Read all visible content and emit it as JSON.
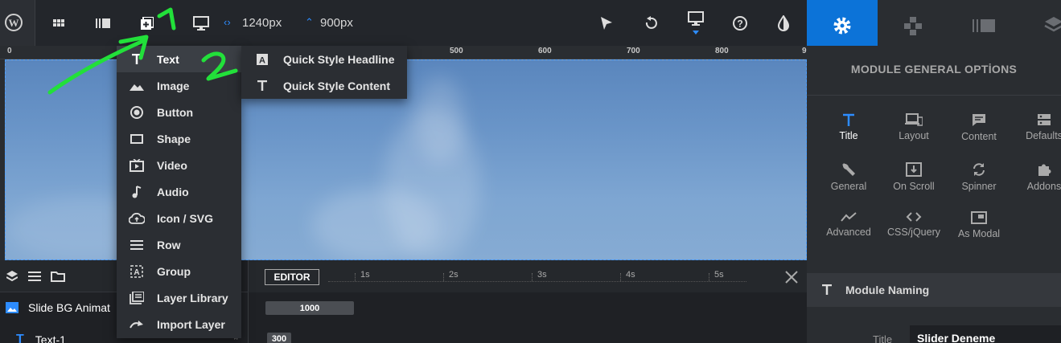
{
  "toolbar": {
    "width_value": "1240px",
    "height_value": "900px"
  },
  "ruler": {
    "labels": [
      "0",
      "500",
      "600",
      "700",
      "800",
      "9"
    ]
  },
  "add_layer_menu": {
    "items": [
      {
        "label": "Text",
        "icon": "text-icon"
      },
      {
        "label": "Image",
        "icon": "image-icon"
      },
      {
        "label": "Button",
        "icon": "button-icon"
      },
      {
        "label": "Shape",
        "icon": "shape-icon"
      },
      {
        "label": "Video",
        "icon": "video-icon"
      },
      {
        "label": "Audio",
        "icon": "audio-icon"
      },
      {
        "label": "Icon / SVG",
        "icon": "cloud-icon"
      },
      {
        "label": "Row",
        "icon": "row-icon"
      },
      {
        "label": "Group",
        "icon": "group-icon"
      },
      {
        "label": "Layer Library",
        "icon": "library-icon"
      },
      {
        "label": "Import Layer",
        "icon": "import-icon"
      }
    ],
    "submenu": [
      {
        "label": "Quick Style Headline",
        "icon": "headline-icon"
      },
      {
        "label": "Quick Style Content",
        "icon": "text-icon"
      }
    ]
  },
  "timeline": {
    "editor_label": "EDITOR",
    "seconds": [
      "1s",
      "2s",
      "3s",
      "4s",
      "5s"
    ],
    "bar1_value": "1000",
    "bar2_value": "300"
  },
  "layers": {
    "rows": [
      "Slide BG Animat",
      "Text-1"
    ]
  },
  "right_panel": {
    "title": "MODULE GENERAL OPTİONS",
    "options": [
      {
        "label": "Title",
        "icon": "text-icon",
        "active": true
      },
      {
        "label": "Layout",
        "icon": "layout-icon"
      },
      {
        "label": "Content",
        "icon": "content-icon"
      },
      {
        "label": "Defaults",
        "icon": "defaults-icon"
      },
      {
        "label": "General",
        "icon": "wrench-icon"
      },
      {
        "label": "On Scroll",
        "icon": "on-scroll-icon"
      },
      {
        "label": "Spinner",
        "icon": "spinner-icon"
      },
      {
        "label": "Addons",
        "icon": "puzzle-icon"
      },
      {
        "label": "Advanced",
        "icon": "chart-icon"
      },
      {
        "label": "CSS/jQuery",
        "icon": "code-icon"
      },
      {
        "label": "As Modal",
        "icon": "modal-icon"
      }
    ],
    "naming_section": "Module Naming",
    "title_field_label": "Title",
    "title_field_value": "Slider Deneme"
  },
  "colors": {
    "accent": "#0c73d8",
    "annotation": "#22e03a"
  }
}
